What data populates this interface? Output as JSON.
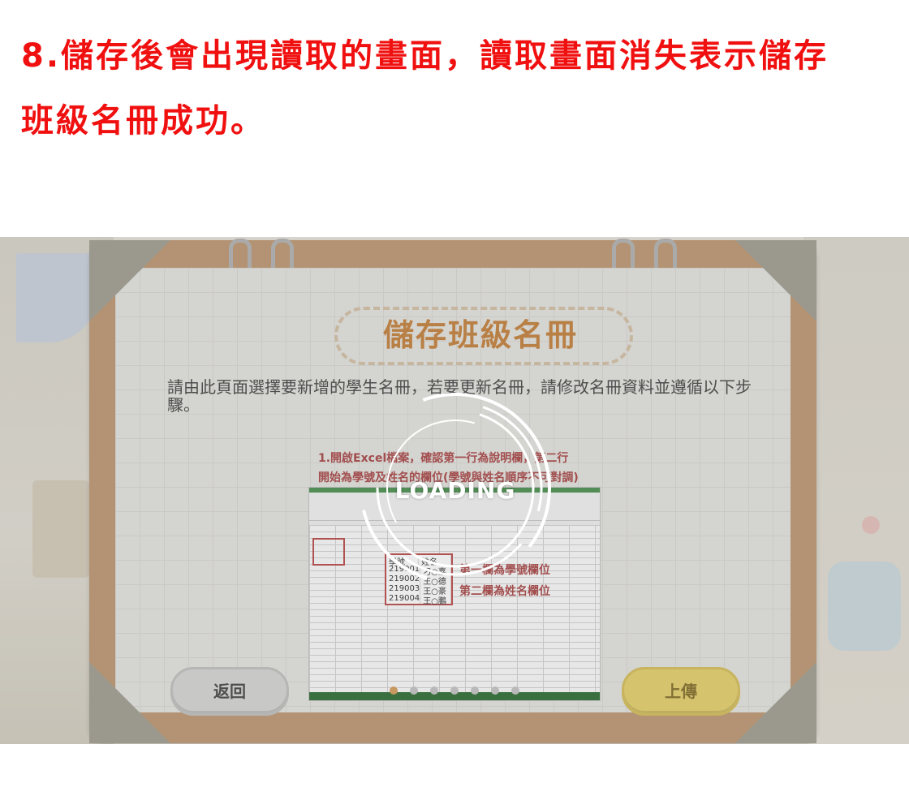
{
  "caption": {
    "line1": "8.儲存後會出現讀取的畫面，讀取畫面消失表示儲存",
    "line2": "班級名冊成功。"
  },
  "dialog": {
    "title": "儲存班級名冊",
    "description": "請由此頁面選擇要新增的學生名冊，若要更新名冊，請修改名冊資料並遵循以下步驟。",
    "step1": "1.開啟Excel檔案，確認第一行為說明欄，第二行",
    "step2": "開始為學號及姓名的欄位(學號與姓名順序不可對調)",
    "table": {
      "headers": [
        "學號",
        "姓名"
      ],
      "rows": [
        [
          "219001",
          "刁○嘉"
        ],
        [
          "219002",
          "王○德"
        ],
        [
          "219003",
          "王○豪"
        ],
        [
          "219004",
          "王○鵬"
        ]
      ]
    },
    "callout1": "第一欄為學號欄位",
    "callout2": "第二欄為姓名欄位",
    "back_label": "返回",
    "upload_label": "上傳",
    "pagination": {
      "count": 7,
      "active_index": 0
    }
  },
  "loading": {
    "label": "LOADING"
  },
  "colors": {
    "caption": "#f01010",
    "title": "#c98b4d",
    "board": "#c3a07d",
    "upload": "#e8d477"
  }
}
